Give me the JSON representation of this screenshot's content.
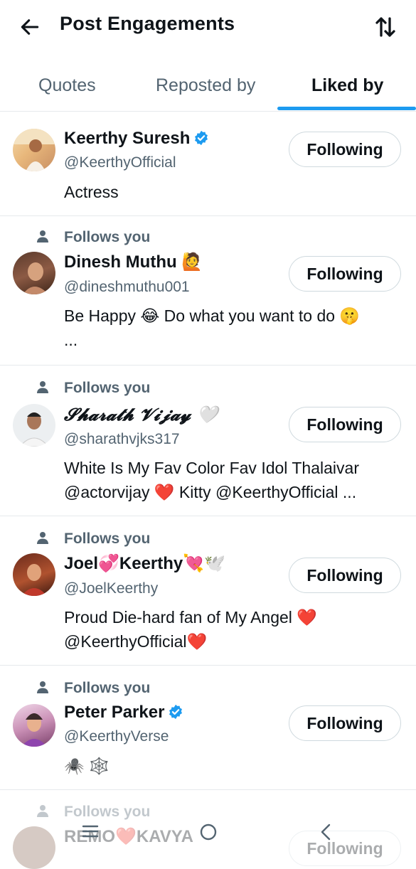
{
  "header": {
    "title": "Post Engagements"
  },
  "tabs": [
    {
      "label": "Quotes"
    },
    {
      "label": "Reposted by"
    },
    {
      "label": "Liked by"
    }
  ],
  "users": [
    {
      "name": "Keerthy Suresh",
      "handle": "@KeerthyOfficial",
      "bio": "Actress",
      "button": "Following",
      "follows_you": ""
    },
    {
      "name": "Dinesh Muthu 🙋",
      "handle": "@dineshmuthu001",
      "bio": "Be Happy 😂  Do what you want to do 🤫\n...",
      "button": "Following",
      "follows_you": "Follows you"
    },
    {
      "name": "𝓢𝓱𝓪𝓻𝓪𝓽𝓱 𝓥𝓲𝓳𝓪𝔂 🤍",
      "handle": "@sharathvjks317",
      "bio": "White Is My Fav Color Fav Idol Thalaivar\n@actorvijay ❤️ Kitty @KeerthyOfficial ...",
      "button": "Following",
      "follows_you": "Follows you"
    },
    {
      "name": "Joel💞Keerthy💘🕊️",
      "handle": "@JoelKeerthy",
      "bio": "Proud Die-hard fan of My Angel ❤️\n@KeerthyOfficial❤️",
      "button": "Following",
      "follows_you": "Follows you"
    },
    {
      "name": "Peter Parker",
      "handle": "@KeerthyVerse",
      "bio": "🕷️ 🕸️",
      "button": "Following",
      "follows_you": "Follows you"
    },
    {
      "name": "REMO❤️KAVYA",
      "handle": "",
      "bio": "",
      "button": "Following",
      "follows_you": "Follows you"
    }
  ],
  "colors": {
    "accent": "#1d9bf0",
    "muted": "#536471",
    "text": "#0f1419"
  }
}
